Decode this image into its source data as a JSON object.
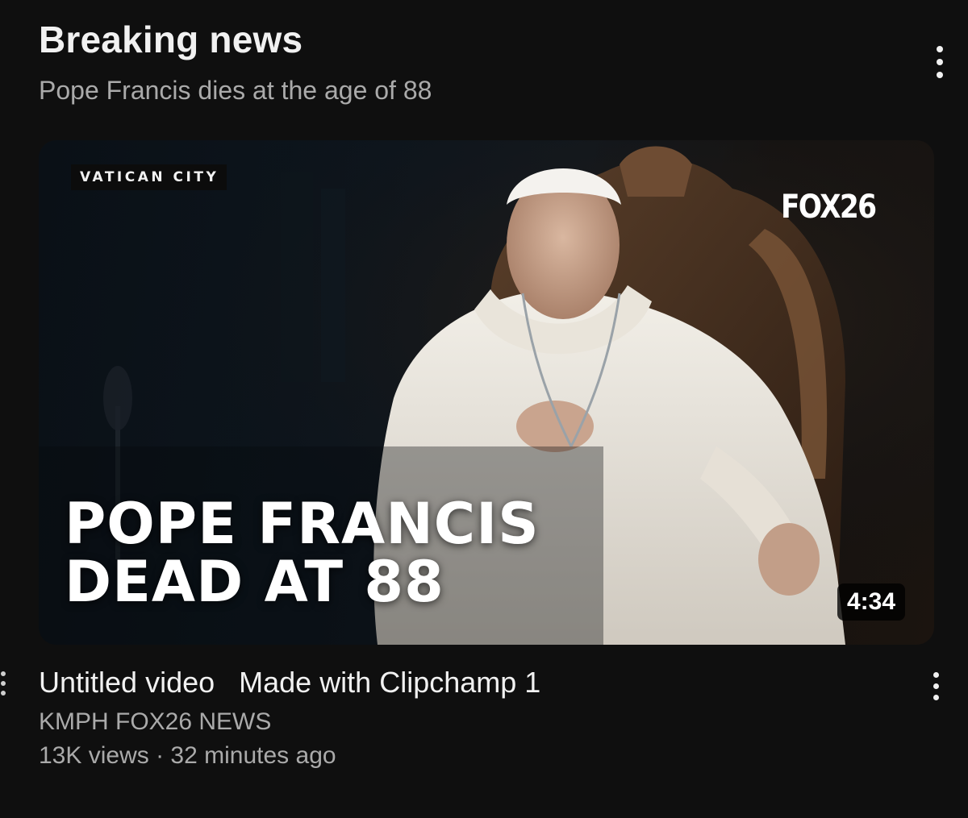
{
  "section": {
    "title": "Breaking news",
    "subtitle": "Pope Francis dies at the age of 88",
    "more_icon": "vertical-ellipsis-icon"
  },
  "video": {
    "thumbnail": {
      "location_tag": "VATICAN CITY",
      "channel_logo": "FOX26",
      "headline_line1": "POPE FRANCIS",
      "headline_line2": "DEAD AT 88",
      "duration": "4:34"
    },
    "title": "Untitled video   Made with Clipchamp 1",
    "channel": "KMPH FOX26 NEWS",
    "views": "13K views",
    "separator": "·",
    "published": "32 minutes ago",
    "more_icon": "vertical-ellipsis-icon"
  },
  "colors": {
    "background": "#0f0f0f",
    "primary_text": "#f1f1f1",
    "secondary_text": "#aaaaaa"
  }
}
